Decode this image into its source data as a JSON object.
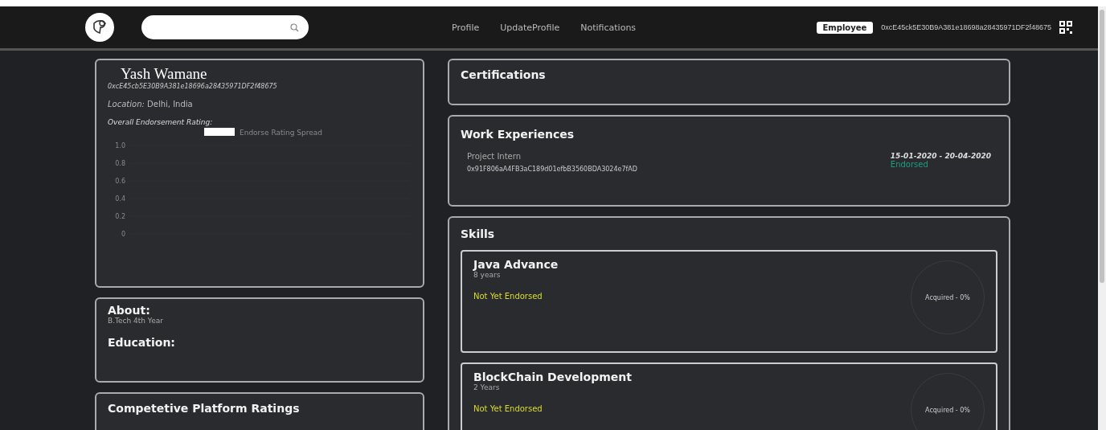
{
  "nav": {
    "links": [
      {
        "label": "Profile",
        "selected": false
      },
      {
        "label": "UpdateProfile",
        "selected": false
      },
      {
        "label": "Notifications",
        "selected": false
      }
    ],
    "role_badge": "Employee",
    "wallet_address": "0xcE45ck5E30B9A381e18698a28435971DF2f48675"
  },
  "profile": {
    "name": "Yash Wamane",
    "address": "0xcE45cb5E30B9A381e18696a28435971DF2f48675",
    "location": "*Location:* Delhi, India",
    "rating_label": "Overall Endorsement Rating:",
    "chart": {
      "legend": "Endorse Rating Spread",
      "y_labels": [
        "1.0",
        "0.8",
        "0.6",
        "0.4",
        "0.2",
        "0"
      ]
    }
  },
  "about": {
    "title": "About:",
    "text": "B.Tech 4th Year",
    "education_title": "Education:"
  },
  "competitive": {
    "title": "Competetive Platform Ratings"
  },
  "certifications": {
    "title": "Certifications"
  },
  "work": {
    "title": "Work Experiences",
    "items": [
      {
        "role": "Project Intern",
        "address": "0x91F806aA4FB3aC189d01efbB3560BDA3024e7fAD",
        "dates": "15-01-2020 - 20-04-2020",
        "status": "Endorsed",
        "endorsed": true
      }
    ]
  },
  "skills": {
    "title": "Skills",
    "items": [
      {
        "name": "Java Advance",
        "years": "8 years",
        "status": "Not Yet Endorsed",
        "endorsed": false,
        "acquired": "Acquired - 0%"
      },
      {
        "name": "BlockChain Development",
        "years": "2 Years",
        "status": "Not Yet Endorsed",
        "endorsed": false,
        "acquired": "Acquired - 0%"
      }
    ]
  }
}
